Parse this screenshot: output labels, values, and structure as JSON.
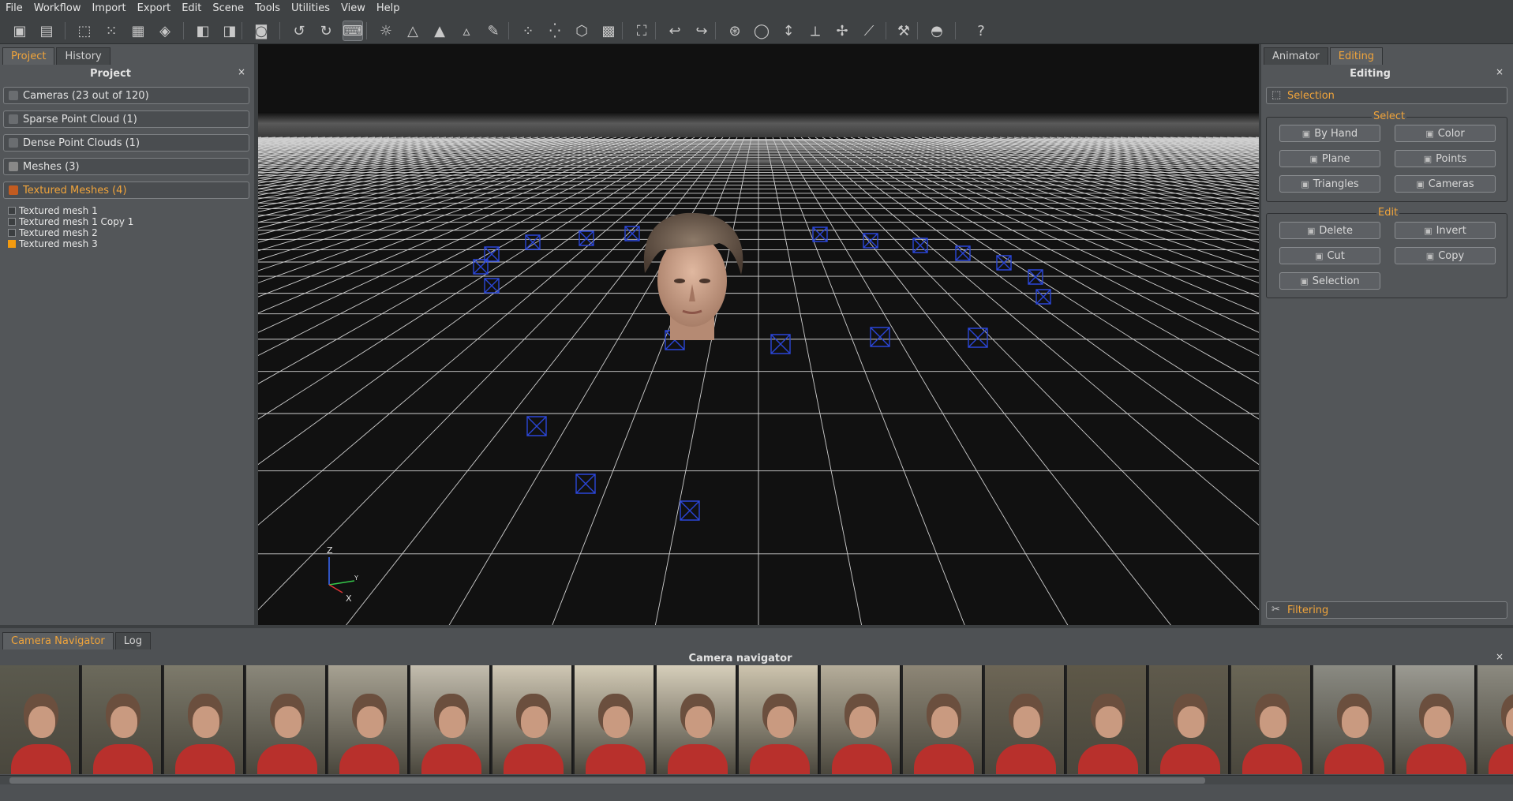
{
  "menu": [
    "File",
    "Workflow",
    "Import",
    "Export",
    "Edit",
    "Scene",
    "Tools",
    "Utilities",
    "View",
    "Help"
  ],
  "toolbar": {
    "tools": [
      {
        "icon": "new-project-icon",
        "glyph": "▣"
      },
      {
        "icon": "save-icon",
        "glyph": "▤"
      },
      {
        "icon": "cameras-view-icon",
        "glyph": "⬚"
      },
      {
        "icon": "sparse-cloud-view-icon",
        "glyph": "⁙"
      },
      {
        "icon": "dense-cloud-view-icon",
        "glyph": "▦"
      },
      {
        "icon": "mesh-view-icon",
        "glyph": "◈"
      },
      {
        "icon": "wireframe-cube-icon",
        "glyph": "◧"
      },
      {
        "icon": "textured-cube-icon",
        "glyph": "◨"
      },
      {
        "icon": "camera-icon",
        "glyph": "◙"
      },
      {
        "icon": "rotate-ccw-icon",
        "glyph": "↺"
      },
      {
        "icon": "rotate-cw-icon",
        "glyph": "↻"
      },
      {
        "icon": "wasd-icon",
        "glyph": "⌨"
      },
      {
        "icon": "light-bulb-icon",
        "glyph": "☼"
      },
      {
        "icon": "vertex-icon",
        "glyph": "△"
      },
      {
        "icon": "normals-icon",
        "glyph": "▲"
      },
      {
        "icon": "shading-icon",
        "glyph": "▵"
      },
      {
        "icon": "paint-brush-icon",
        "glyph": "✎"
      },
      {
        "icon": "points-icon",
        "glyph": "⁘"
      },
      {
        "icon": "point-cloud-icon",
        "glyph": "⁛"
      },
      {
        "icon": "box-icon",
        "glyph": "⬡"
      },
      {
        "icon": "colored-box-icon",
        "glyph": "▩"
      },
      {
        "icon": "fit-view-icon",
        "glyph": "⛶"
      },
      {
        "icon": "undo-icon",
        "glyph": "↩"
      },
      {
        "icon": "redo-icon",
        "glyph": "↪"
      },
      {
        "icon": "orbit-icon",
        "glyph": "⊛"
      },
      {
        "icon": "rotate-icon",
        "glyph": "◯"
      },
      {
        "icon": "move-vertical-icon",
        "glyph": "↕"
      },
      {
        "icon": "axis-gizmo-icon",
        "glyph": "⟂"
      },
      {
        "icon": "transform-icon",
        "glyph": "✢"
      },
      {
        "icon": "ruler-icon",
        "glyph": "⟋"
      },
      {
        "icon": "tools-icon",
        "glyph": "⚒"
      },
      {
        "icon": "mask-icon",
        "glyph": "◓"
      },
      {
        "icon": "help-icon",
        "glyph": "?"
      }
    ]
  },
  "left_panel": {
    "tabs": [
      "Project",
      "History"
    ],
    "title": "Project",
    "close": "×",
    "groups": [
      {
        "label": "Cameras (23 out of 120)",
        "icon": "camera-group-icon"
      },
      {
        "label": "Sparse Point Cloud (1)",
        "icon": "sparse-cloud-icon"
      },
      {
        "label": "Dense Point Clouds (1)",
        "icon": "dense-cloud-icon"
      },
      {
        "label": "Meshes (3)",
        "icon": "mesh-icon"
      },
      {
        "label": "Textured Meshes (4)",
        "icon": "textured-mesh-icon"
      }
    ],
    "items": [
      "Textured mesh 1",
      "Textured mesh 1 Copy 1",
      "Textured mesh 2",
      "Textured mesh 3"
    ]
  },
  "viewport": {
    "axis": {
      "z": "Z",
      "y": "Y",
      "x": "X"
    }
  },
  "right_panel": {
    "tabs": [
      "Animator",
      "Editing"
    ],
    "title": "Editing",
    "close": "×",
    "selection_header": "Selection",
    "select_label": "Select",
    "select_buttons": [
      {
        "label": "By Hand",
        "icon": "by-hand-icon"
      },
      {
        "label": "Color",
        "icon": "color-icon"
      },
      {
        "label": "Plane",
        "icon": "plane-icon"
      },
      {
        "label": "Points",
        "icon": "points-select-icon"
      },
      {
        "label": "Triangles",
        "icon": "triangles-icon"
      },
      {
        "label": "Cameras",
        "icon": "cameras-select-icon"
      }
    ],
    "edit_label": "Edit",
    "edit_buttons": [
      {
        "label": "Delete",
        "icon": "delete-icon"
      },
      {
        "label": "Invert",
        "icon": "invert-icon"
      },
      {
        "label": "Cut",
        "icon": "cut-icon"
      },
      {
        "label": "Copy",
        "icon": "copy-icon"
      },
      {
        "label": "Selection",
        "icon": "selection-icon"
      }
    ],
    "filtering_header": "Filtering"
  },
  "bottom": {
    "tabs": [
      "Camera Navigator",
      "Log"
    ],
    "title": "Camera navigator",
    "close": "×"
  }
}
